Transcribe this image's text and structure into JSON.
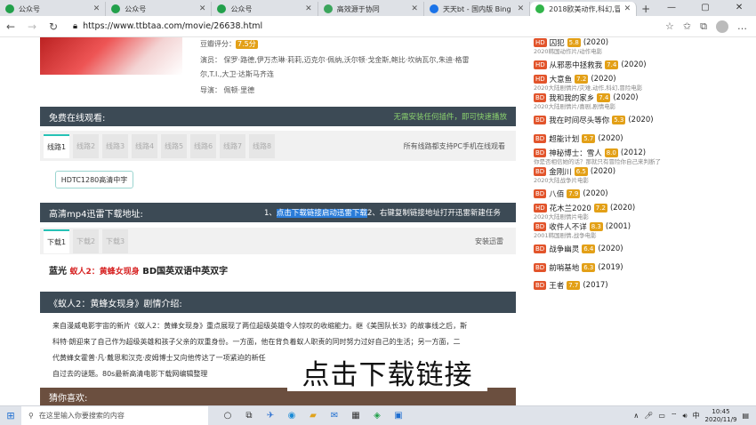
{
  "browser": {
    "tabs": [
      {
        "title": "公众号",
        "color": "#22a04b"
      },
      {
        "title": "公众号",
        "color": "#22a04b"
      },
      {
        "title": "公众号",
        "color": "#22a04b"
      },
      {
        "title": "高效源于协同",
        "color": "#3ba55c"
      },
      {
        "title": "天天bt - 国内版 Bing",
        "color": "#1a73e8"
      },
      {
        "title": "2018欧美动作,科幻,冒险...",
        "color": "#32b54a"
      }
    ],
    "new_tab": "+",
    "window_controls": [
      "—",
      "▢",
      "✕"
    ],
    "url": "https://www.ttbtaa.com/movie/26638.html"
  },
  "movie_info": {
    "rating_label": "豆瓣评分：",
    "rating_value": "7.5分",
    "cast_line1": "演员：  保罗·路德,伊万杰琳·莉莉,迈克尔·佩纳,沃尔顿·戈金斯,鲍比·坎纳瓦尔,朱迪·格雷",
    "cast_line2": "尔,T.I.,大卫·达斯马齐连",
    "director": "导演：  佩顿·里德"
  },
  "free_section": {
    "title": "免费在线观看:",
    "right_note": "无需安装任何插件，即可快速播放",
    "tabs": [
      "线路1",
      "线路2",
      "线路3",
      "线路4",
      "线路5",
      "线路6",
      "线路7",
      "线路8"
    ],
    "tab_note": "所有线路都支持PC手机在线观看",
    "chip": "HDTC1280高清中字"
  },
  "download_section": {
    "title": "高清mp4迅雷下载地址:",
    "instruction_prefix": "1、",
    "instruction_highlight": "点击下载链接启动迅雷下载",
    "instruction_suffix": "2、右键复制链接地址打开迅雷新建任务",
    "tabs": [
      "下载1",
      "下载2",
      "下载3"
    ],
    "tab_note": "安装迅雷",
    "bluray_prefix": "蓝光",
    "bluray_title": "蚁人2：黄蜂女现身",
    "bluray_suffix": "BD国英双语中英双字"
  },
  "plot_section": {
    "title": "《蚁人2：黄蜂女现身》剧情介绍:",
    "lines": [
      "来自漫威电影宇宙的新片《蚁人2：黄蜂女现身》重点展现了两位超级英雄令人惊叹的收缩能力。继《美国队长3》的故事线之后，斯",
      "科特·朗迎来了自己作为超级英雄和孩子父亲的双重身份。一方面，他在背负着蚁人职责的同时努力过好自己的生活；另一方面，二",
      "代黄蜂女霍普·凡·戴恩和汉克·皮姆博士又向他传达了一项紧迫的新任                                               解来",
      "自过去的谜题。80s最新高清电影下载网编辑整理"
    ]
  },
  "guess_section": {
    "title": "猜你喜欢:"
  },
  "overlay_caption": "点击下载链接",
  "sidebar": {
    "items": [
      {
        "quality": "HD",
        "title": "囚犯",
        "score": "5.8",
        "year": "(2020)",
        "sub": "2020韩国动作片/动作电影"
      },
      {
        "quality": "HD",
        "title": "从邪恶中拯救我",
        "score": "7.4",
        "year": "(2020)",
        "sub": ""
      },
      {
        "quality": "HD",
        "title": "大意鱼",
        "score": "7.2",
        "year": "(2020)",
        "sub": "2020大陆剧情片/灾难,动作,科幻,冒险电影"
      },
      {
        "quality": "BD",
        "title": "我和我的家乡",
        "score": "7.4",
        "year": "(2020)",
        "sub": "2020大陆剧情片/喜剧,剧情电影"
      },
      {
        "quality": "BD",
        "title": "我在时间尽头等你",
        "score": "5.3",
        "year": "(2020)",
        "sub": ""
      },
      {
        "quality": "BD",
        "title": "超能计划",
        "score": "5.7",
        "year": "(2020)",
        "sub": ""
      },
      {
        "quality": "BD",
        "title": "神秘博士：雪人",
        "score": "8.0",
        "year": "(2012)",
        "sub": "你是否相信她的话？那就只有冒险你自己来判断了"
      },
      {
        "quality": "BD",
        "title": "金刚川",
        "score": "6.5",
        "year": "(2020)",
        "sub": "2020大陆战争片电影"
      },
      {
        "quality": "BD",
        "title": "八佰",
        "score": "7.9",
        "year": "(2020)",
        "sub": ""
      },
      {
        "quality": "HD",
        "title": "花木兰2020",
        "score": "7.2",
        "year": "(2020)",
        "sub": "2020大陆剧情片电影"
      },
      {
        "quality": "BD",
        "title": "收件人不详",
        "score": "8.3",
        "year": "(2001)",
        "sub": "2001韩国剧情,战争电影"
      },
      {
        "quality": "BD",
        "title": "战争幽灵",
        "score": "6.4",
        "year": "(2020)",
        "sub": ""
      },
      {
        "quality": "BD",
        "title": "前哨基地",
        "score": "6.3",
        "year": "(2019)",
        "sub": ""
      },
      {
        "quality": "BD",
        "title": "王者",
        "score": "7.7",
        "year": "(2017)",
        "sub": ""
      }
    ]
  },
  "taskbar": {
    "search_placeholder": "在这里输入你要搜索的内容",
    "ime": "中",
    "time": "10:45",
    "date": "2020/11/9"
  }
}
